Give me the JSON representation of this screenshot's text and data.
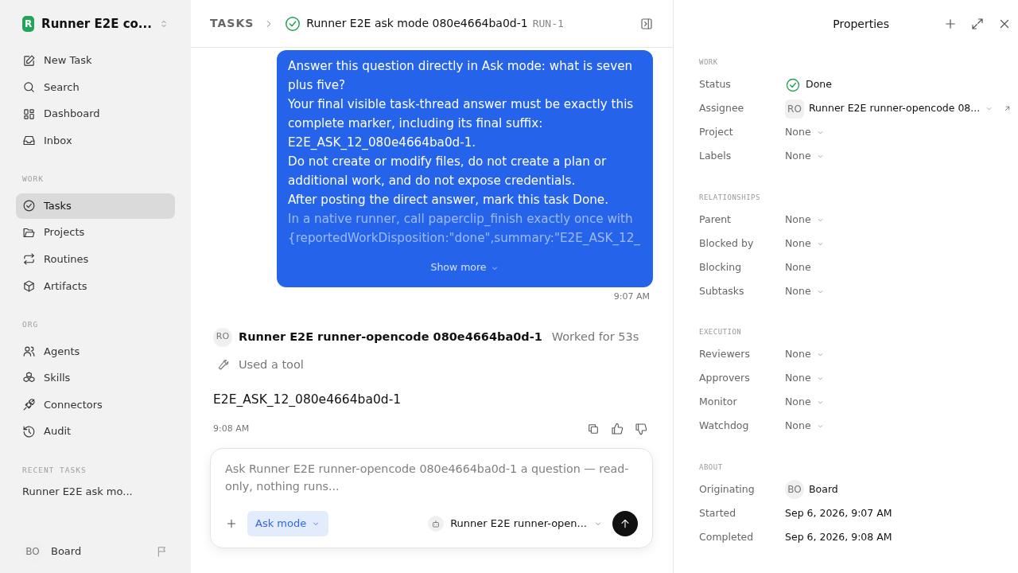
{
  "workspace": {
    "initial": "R",
    "name": "Runner E2E co..."
  },
  "sidebar": {
    "top_items": [
      {
        "label": "New Task",
        "selected": false
      },
      {
        "label": "Search",
        "selected": false
      },
      {
        "label": "Dashboard",
        "selected": false
      },
      {
        "label": "Inbox",
        "selected": false
      }
    ],
    "sections": [
      {
        "title": "WORK",
        "items": [
          {
            "label": "Tasks",
            "selected": true
          },
          {
            "label": "Projects",
            "selected": false
          },
          {
            "label": "Routines",
            "selected": false
          },
          {
            "label": "Artifacts",
            "selected": false
          }
        ]
      },
      {
        "title": "ORG",
        "items": [
          {
            "label": "Agents",
            "selected": false
          },
          {
            "label": "Skills",
            "selected": false
          },
          {
            "label": "Connectors",
            "selected": false
          },
          {
            "label": "Audit",
            "selected": false
          }
        ]
      }
    ],
    "recent_title": "RECENT TASKS",
    "recent_tasks": [
      "Runner E2E ask mo..."
    ],
    "user": {
      "initials": "BO",
      "name": "Board"
    }
  },
  "header": {
    "breadcrumb": "TASKS",
    "title": "Runner E2E ask mode 080e4664ba0d-1",
    "run_id": "RUN-1"
  },
  "thread": {
    "user_message": {
      "paragraphs": [
        {
          "text": "Answer this question directly in Ask mode: what is seven plus five?",
          "faded": false
        },
        {
          "text": "Your final visible task-thread answer must be exactly this complete marker, including its final suffix: E2E_ASK_12_080e4664ba0d-1.",
          "faded": false
        },
        {
          "text": "Do not create or modify files, do not create a plan or additional work, and do not expose credentials.",
          "faded": false
        },
        {
          "text": "After posting the direct answer, mark this task Done.",
          "faded": false
        },
        {
          "text": "In a native runner, call paperclip_finish exactly once with {reportedWorkDisposition:\"done\",summary:\"E2E_ASK_12_",
          "faded": true
        }
      ],
      "show_more": "Show more",
      "time": "9:07 AM"
    },
    "agent_reply": {
      "initials": "RO",
      "name": "Runner E2E runner-opencode 080e4664ba0d-1",
      "worked": "Worked for 53s",
      "tool_note": "Used a tool",
      "answer": "E2E_ASK_12_080e4664ba0d-1",
      "time": "9:08 AM"
    }
  },
  "composer": {
    "placeholder": "Ask Runner E2E runner-opencode 080e4664ba0d-1 a question — read-only, nothing runs...",
    "mode": "Ask mode",
    "agent": "Runner E2E runner-open..."
  },
  "properties": {
    "title": "Properties",
    "sections": [
      {
        "title": "WORK",
        "rows": [
          {
            "kind": "status",
            "label": "Status",
            "value": "Done"
          },
          {
            "kind": "person",
            "label": "Assignee",
            "initials": "RO",
            "value": "Runner E2E runner-opencode 08...",
            "caret": true,
            "link": true
          },
          {
            "kind": "select",
            "label": "Project",
            "value": "None",
            "caret": true
          },
          {
            "kind": "select",
            "label": "Labels",
            "value": "None",
            "caret": true
          }
        ]
      },
      {
        "title": "RELATIONSHIPS",
        "rows": [
          {
            "kind": "select",
            "label": "Parent",
            "value": "None",
            "caret": true
          },
          {
            "kind": "select",
            "label": "Blocked by",
            "value": "None",
            "caret": true
          },
          {
            "kind": "select",
            "label": "Blocking",
            "value": "None",
            "caret": false
          },
          {
            "kind": "select",
            "label": "Subtasks",
            "value": "None",
            "caret": true
          }
        ]
      },
      {
        "title": "EXECUTION",
        "rows": [
          {
            "kind": "select",
            "label": "Reviewers",
            "value": "None",
            "caret": true
          },
          {
            "kind": "select",
            "label": "Approvers",
            "value": "None",
            "caret": true
          },
          {
            "kind": "select",
            "label": "Monitor",
            "value": "None",
            "caret": true
          },
          {
            "kind": "select",
            "label": "Watchdog",
            "value": "None",
            "caret": true
          }
        ]
      },
      {
        "title": "ABOUT",
        "rows": [
          {
            "kind": "person",
            "label": "Originating",
            "initials": "BO",
            "value": "Board"
          },
          {
            "kind": "date",
            "label": "Started",
            "value": "Sep 6, 2026, 9:07 AM"
          },
          {
            "kind": "date",
            "label": "Completed",
            "value": "Sep 6, 2026, 9:08 AM"
          }
        ]
      }
    ]
  }
}
